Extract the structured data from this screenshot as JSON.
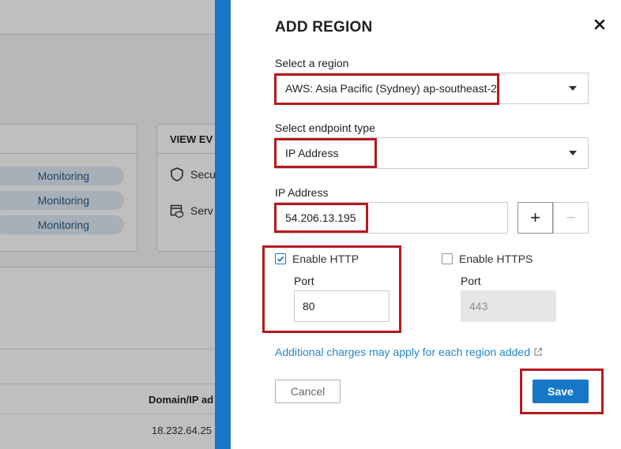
{
  "background": {
    "monitoring_pills": [
      "Monitoring",
      "Monitoring",
      "Monitoring"
    ],
    "view_events_title": "VIEW EV",
    "view_events_items": [
      {
        "label": "Secu",
        "icon": "shield-icon"
      },
      {
        "label": "Serv",
        "icon": "calendar-shield-icon"
      }
    ],
    "table_header": "Domain/IP ad",
    "table_cell": "18.232.64.25"
  },
  "modal": {
    "title": "ADD REGION",
    "region_label": "Select a region",
    "region_value": "AWS: Asia Pacific (Sydney) ap-southeast-2",
    "endpoint_label": "Select endpoint type",
    "endpoint_value": "IP Address",
    "ip_label": "IP Address",
    "ip_value": "54.206.13.195",
    "add_symbol": "+",
    "remove_symbol": "−",
    "http": {
      "label": "Enable HTTP",
      "checked": true,
      "port_label": "Port",
      "port_value": "80"
    },
    "https": {
      "label": "Enable HTTPS",
      "checked": false,
      "port_label": "Port",
      "port_placeholder": "443"
    },
    "charges_text": "Additional charges may apply for each region added",
    "cancel_label": "Cancel",
    "save_label": "Save"
  },
  "colors": {
    "accent": "#1677c7",
    "annotation_red": "#b51a1d",
    "link": "#2386c8"
  }
}
